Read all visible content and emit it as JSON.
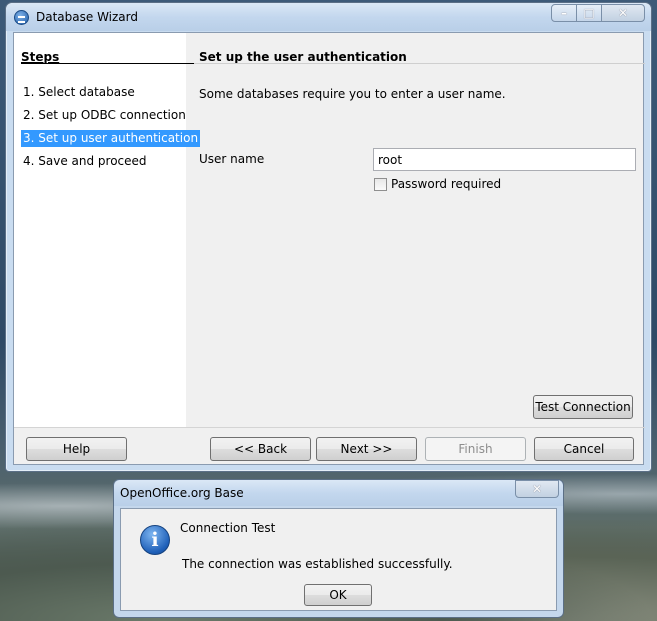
{
  "window": {
    "title": "Database Wizard",
    "steps_title": "Steps",
    "steps": [
      {
        "label": "1. Select database",
        "selected": false
      },
      {
        "label": "2. Set up ODBC connection",
        "selected": false
      },
      {
        "label": "3. Set up user authentication",
        "selected": true
      },
      {
        "label": "4. Save and proceed",
        "selected": false
      }
    ],
    "page_title": "Set up the user authentication",
    "description": "Some databases require you to enter a user name.",
    "user_name_label": "User name",
    "user_name_value": "root",
    "password_required_label": "Password required",
    "password_required_checked": false,
    "test_connection_label": "Test Connection",
    "buttons": {
      "help": "Help",
      "back": "<< Back",
      "next": "Next >>",
      "finish": "Finish",
      "cancel": "Cancel"
    }
  },
  "message_box": {
    "title": "OpenOffice.org Base",
    "heading": "Connection Test",
    "text": "The connection was established successfully.",
    "ok_label": "OK",
    "icon": "info-icon"
  },
  "colors": {
    "selection": "#3399ff",
    "titlebar": "#c3d7ee"
  }
}
